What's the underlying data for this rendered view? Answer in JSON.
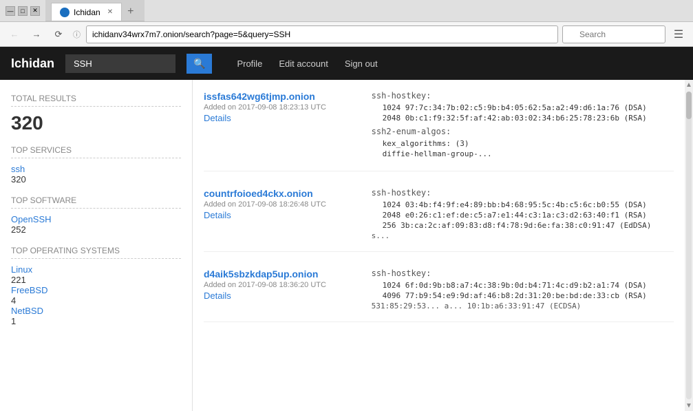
{
  "window": {
    "title": "Ichidan",
    "controls": {
      "minimize": "—",
      "maximize": "□",
      "close": "✕"
    }
  },
  "tabs": [
    {
      "label": "Ichidan",
      "active": true
    }
  ],
  "address_bar": {
    "url": "ichidanv34wrx7m7.onion/search?page=5&query=SSH",
    "search_placeholder": "Search"
  },
  "header": {
    "logo": "Ichidan",
    "search_value": "SSH",
    "nav_links": [
      "Profile",
      "Edit account",
      "Sign out"
    ]
  },
  "sidebar": {
    "total_results_label": "Total Results",
    "total_results_value": "320",
    "top_services_label": "Top Services",
    "services": [
      {
        "name": "ssh",
        "count": "320"
      }
    ],
    "top_software_label": "Top Software",
    "software": [
      {
        "name": "OpenSSH",
        "count": "252"
      }
    ],
    "top_os_label": "Top Operating Systems",
    "os_list": [
      {
        "name": "Linux",
        "count": "221"
      },
      {
        "name": "FreeBSD",
        "count": "4"
      },
      {
        "name": "NetBSD",
        "count": "1"
      }
    ]
  },
  "results": [
    {
      "domain": "issfas642wg6tjmp.onion",
      "added": "Added on 2017-09-08 18:23:13 UTC",
      "details": "Details",
      "ssh_hostkey_label": "ssh-hostkey:",
      "keys": [
        "1024 97:7c:34:7b:02:c5:9b:b4:05:62:5a:a2:49:d6:1a:76 (DSA)",
        "2048 0b:c1:f9:32:5f:af:42:ab:03:02:34:b6:25:78:23:6b (RSA)"
      ],
      "enum_label": "ssh2-enum-algos:",
      "enum_lines": [
        "kex_algorithms: (3)",
        "diffie-hellman-group-..."
      ],
      "extra": ""
    },
    {
      "domain": "countrfoioed4ckx.onion",
      "added": "Added on 2017-09-08 18:26:48 UTC",
      "details": "Details",
      "ssh_hostkey_label": "ssh-hostkey:",
      "keys": [
        "1024 03:4b:f4:9f:e4:89:bb:b4:68:95:5c:4b:c5:6c:b0:55 (DSA)",
        "2048 e0:26:c1:ef:de:c5:a7:e1:44:c3:1a:c3:d2:63:40:f1 (RSA)",
        "256 3b:ca:2c:af:09:83:d8:f4:78:9d:6e:fa:38:c0:91:47 (EdDSA)"
      ],
      "enum_label": "",
      "enum_lines": [],
      "extra": "s..."
    },
    {
      "domain": "d4aik5sbzkdap5up.onion",
      "added": "Added on 2017-09-08 18:36:20 UTC",
      "details": "Details",
      "ssh_hostkey_label": "ssh-hostkey:",
      "keys": [
        "1024 6f:0d:9b:b8:a7:4c:38:9b:0d:b4:71:4c:d9:b2:a1:74 (DSA)",
        "4096 77:b9:54:e9:9d:af:46:b8:2d:31:20:be:bd:de:33:cb (RSA)"
      ],
      "enum_label": "",
      "enum_lines": [],
      "extra": "531:85:29:53... a... 10:1b:a6:33:91:47 (ECDSA)"
    }
  ]
}
